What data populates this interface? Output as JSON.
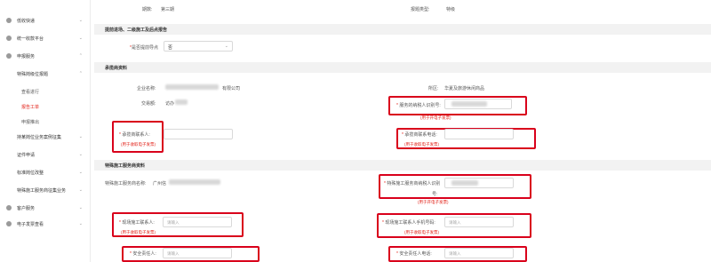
{
  "sidebar": {
    "items": [
      {
        "label": "低收快递"
      },
      {
        "label": "统一收款平台"
      },
      {
        "label": "申报服务"
      },
      {
        "label": "特殊岗级位报题"
      },
      {
        "label": "查看进行"
      },
      {
        "label": "报告工单"
      },
      {
        "label": "申报推出"
      },
      {
        "label": "持某岗位业务案例征集"
      },
      {
        "label": "证件申请"
      },
      {
        "label": "标准岗位改整"
      },
      {
        "label": "特殊施工服务商征集业务"
      },
      {
        "label": "客户服务"
      },
      {
        "label": "电子发票查看"
      }
    ]
  },
  "top": {
    "period_label": "期数:",
    "period_value": "第三期",
    "type_label": "报题类型:",
    "type_value": "特级"
  },
  "section1": {
    "title": "提前进场、二级施工及后点报告",
    "field_label": "是否提前导点",
    "field_required": "*",
    "select_value": "否"
  },
  "section2": {
    "title": "承揽商资料",
    "company_label": "企业名称:",
    "company_suffix": "有限公司",
    "area_label": "所区:",
    "area_value": "华夏及旅游休闲商品",
    "trade_label": "交易额:",
    "trade_value": "访办",
    "taxid_label": "服务的纳税人识别号:",
    "contact_label": "承揽商联系人:",
    "contact_hint": "(用于收取电子发票)",
    "phone_label": "承揽商联系电话:",
    "phone_hint": "(用于收取电子发票)",
    "taxid_hint": "(用于开电子发票)"
  },
  "section3": {
    "title": "特殊施工服务商资料",
    "name_label": "特殊施工服务商名称:",
    "name_value": "广州信",
    "taxid_label": "特殊施工服务商纳税人识别",
    "taxid_label2": "号:",
    "taxid_hint": "(用于开电子发票)",
    "site_contact_label": "现场施工联系人:",
    "site_contact_placeholder": "请输入",
    "site_contact_hint": "(用于收取电子发票)",
    "site_phone_label": "现场施工联系人手机号码:",
    "site_phone_placeholder": "请输入",
    "site_phone_hint": "(用于收取电子发票)",
    "safety_label": "安全责任人:",
    "safety_placeholder": "请输入",
    "safety_phone_label": "安全责任人电话:",
    "safety_phone_placeholder": "请输入"
  },
  "colors": {
    "accent_red": "#d9001b",
    "section_bg": "#f2f2f2"
  }
}
